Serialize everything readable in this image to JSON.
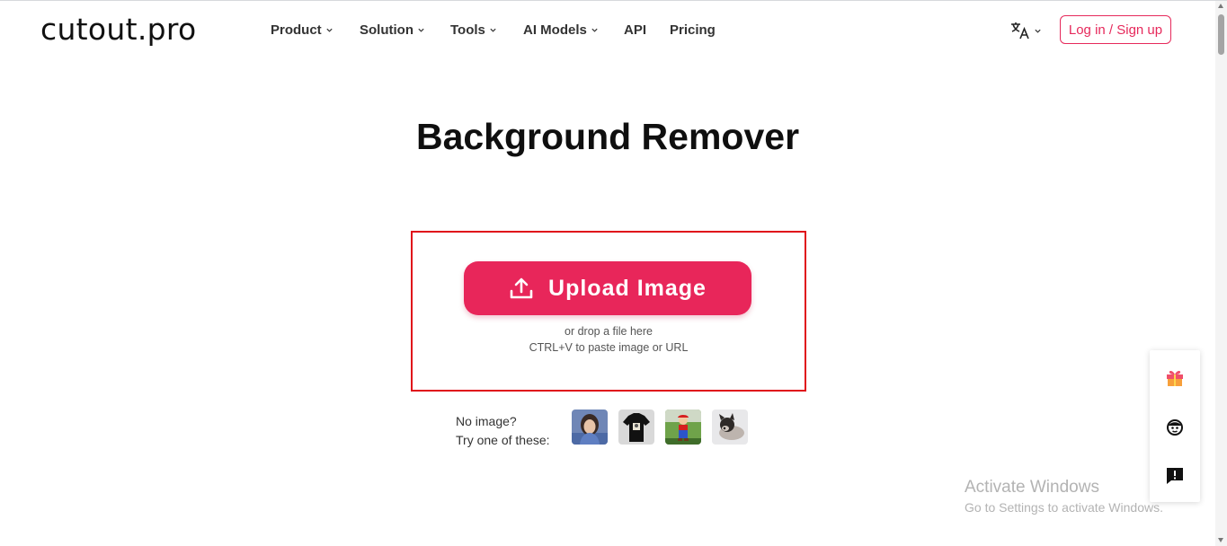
{
  "header": {
    "logo": "cutout.pro",
    "nav": [
      {
        "label": "Product",
        "has_dropdown": true
      },
      {
        "label": "Solution",
        "has_dropdown": true
      },
      {
        "label": "Tools",
        "has_dropdown": true
      },
      {
        "label": "AI Models",
        "has_dropdown": true
      },
      {
        "label": "API",
        "has_dropdown": false
      },
      {
        "label": "Pricing",
        "has_dropdown": false
      }
    ],
    "language_icon": "translate-icon",
    "login_label": "Log in / Sign up"
  },
  "hero": {
    "title": "Background Remover"
  },
  "upload": {
    "button_label": "Upload Image",
    "button_icon": "upload-icon",
    "hint_drop": "or drop a file here",
    "hint_paste": "CTRL+V to paste image or URL"
  },
  "samples": {
    "line1": "No image?",
    "line2": "Try one of these:",
    "items": [
      {
        "name": "sample-girl"
      },
      {
        "name": "sample-tshirt"
      },
      {
        "name": "sample-mario"
      },
      {
        "name": "sample-puppy"
      }
    ]
  },
  "side_panel": {
    "icons": [
      "gift-icon",
      "support-agent-icon",
      "feedback-icon"
    ]
  },
  "windows_watermark": {
    "title": "Activate Windows",
    "subtitle": "Go to Settings to activate Windows."
  },
  "colors": {
    "accent": "#e8265a",
    "upload_box_border": "#e0101a"
  }
}
